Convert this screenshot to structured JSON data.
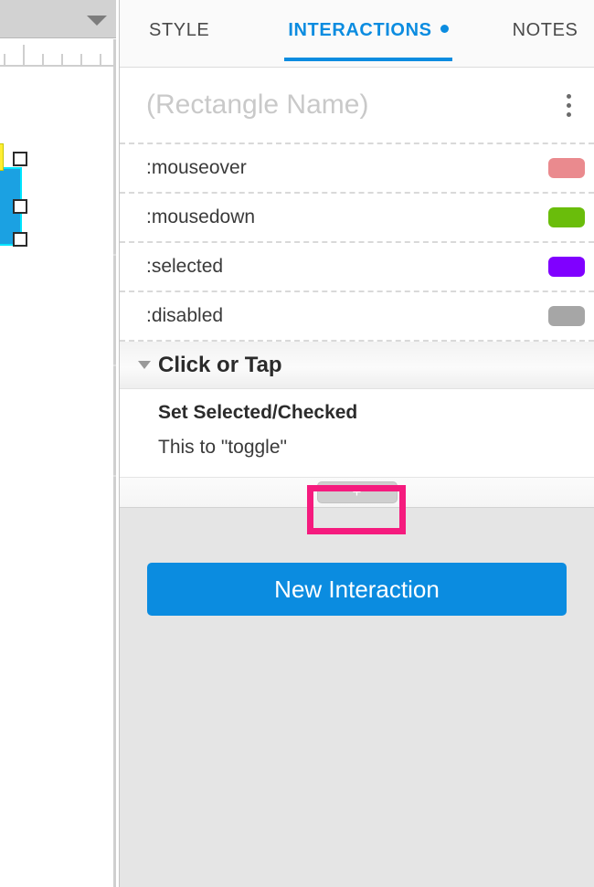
{
  "canvas": {
    "toolbar_caret_icon": "caret-down-icon",
    "shape": {
      "name": "selected-rectangle",
      "fill_color": "#1ba1e2",
      "outline_color": "#00e5ff",
      "badge_icon": "lightning-bolt-icon",
      "badge_color": "#ffee33"
    },
    "handles": [
      "top-handle",
      "middle-handle",
      "bottom-handle"
    ]
  },
  "inspector": {
    "tabs": [
      {
        "label": "STYLE",
        "active": false,
        "has_dot": false
      },
      {
        "label": "INTERACTIONS",
        "active": true,
        "has_dot": true
      },
      {
        "label": "NOTES",
        "active": false,
        "has_dot": false
      }
    ],
    "active_tab_color": "#0b8ce0",
    "name_field": {
      "value": "",
      "placeholder": "(Rectangle Name)"
    },
    "overflow_menu_icon": "kebab-menu-icon",
    "states": [
      {
        "label": ":mouseover",
        "color": "#ea8a8e"
      },
      {
        "label": ":mousedown",
        "color": "#6abd0b"
      },
      {
        "label": ":selected",
        "color": "#8000ff"
      },
      {
        "label": ":disabled",
        "color": "#a6a6a6"
      }
    ],
    "event_group": {
      "disclosure_icon": "triangle-down-icon",
      "title": "Click or Tap",
      "action_title": "Set Selected/Checked",
      "action_detail": "This to \"toggle\""
    },
    "add_bar": {
      "button_label": "+",
      "highlight_color": "#f51b7e"
    },
    "cta": {
      "label": "New Interaction",
      "color": "#0b8ce0"
    }
  }
}
